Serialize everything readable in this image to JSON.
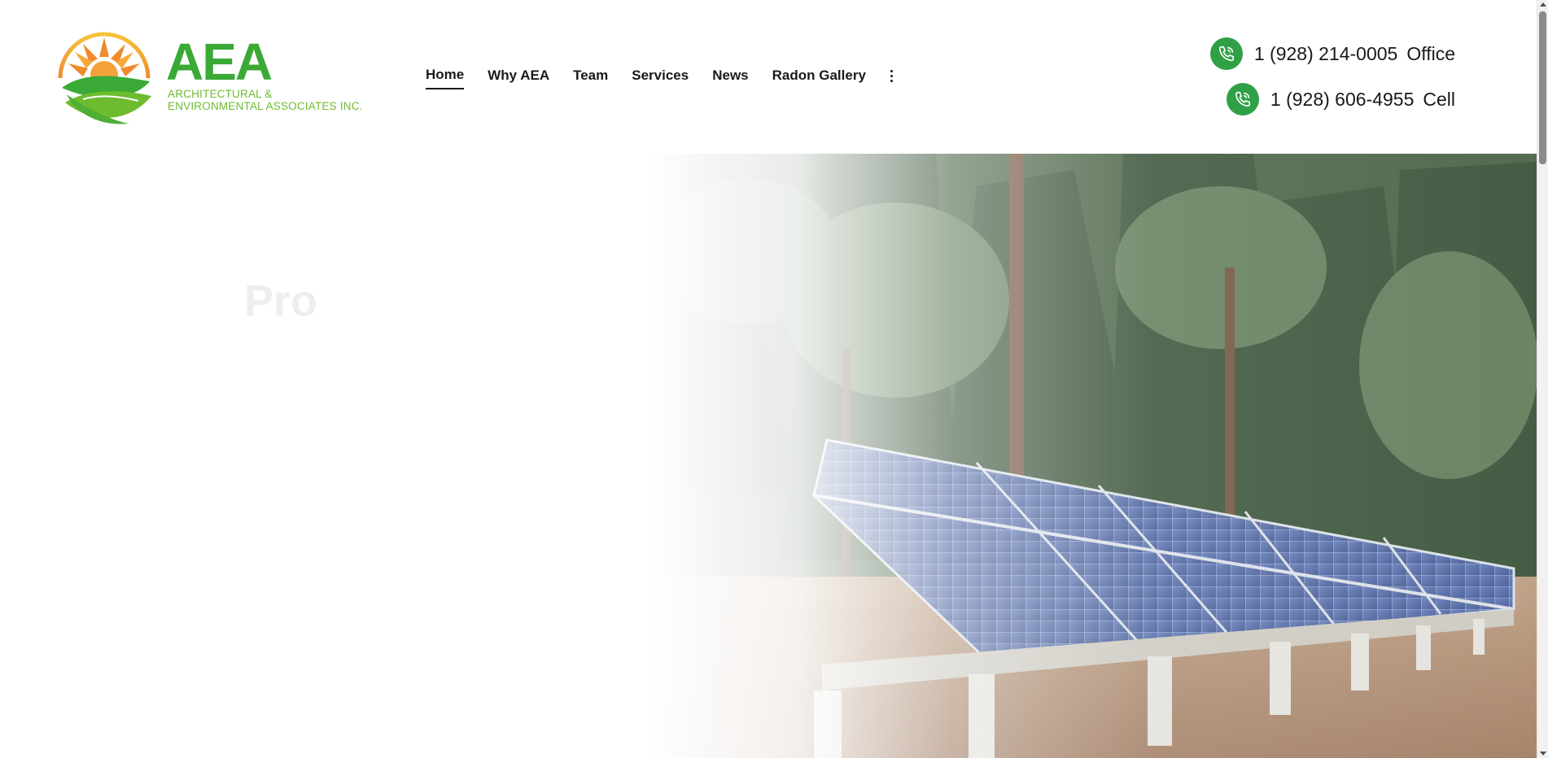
{
  "brand": {
    "name": "AEA",
    "subtitle_line1": "ARCHITECTURAL &",
    "subtitle_line2": "ENVIRONMENTAL ASSOCIATES INC.",
    "colors": {
      "primary_green": "#3aa935",
      "light_green": "#6dbb2e",
      "sun_orange": "#f0892b",
      "sun_yellow": "#f6c33c"
    }
  },
  "nav": {
    "items": [
      {
        "label": "Home",
        "active": true
      },
      {
        "label": "Why AEA",
        "active": false
      },
      {
        "label": "Team",
        "active": false
      },
      {
        "label": "Services",
        "active": false
      },
      {
        "label": "News",
        "active": false
      },
      {
        "label": "Radon Gallery",
        "active": false
      }
    ],
    "more_icon": "vertical-ellipsis-icon"
  },
  "contact": {
    "office": {
      "number": "1 (928) 214-0005",
      "label": "Office",
      "icon": "phone-icon"
    },
    "cell": {
      "number": "1 (928) 606-4955",
      "label": "Cell",
      "icon": "phone-icon"
    },
    "icon_color": "#2fa046"
  },
  "hero": {
    "title_partial": "Pro",
    "image_subject": "solar panel array among pine trees"
  }
}
